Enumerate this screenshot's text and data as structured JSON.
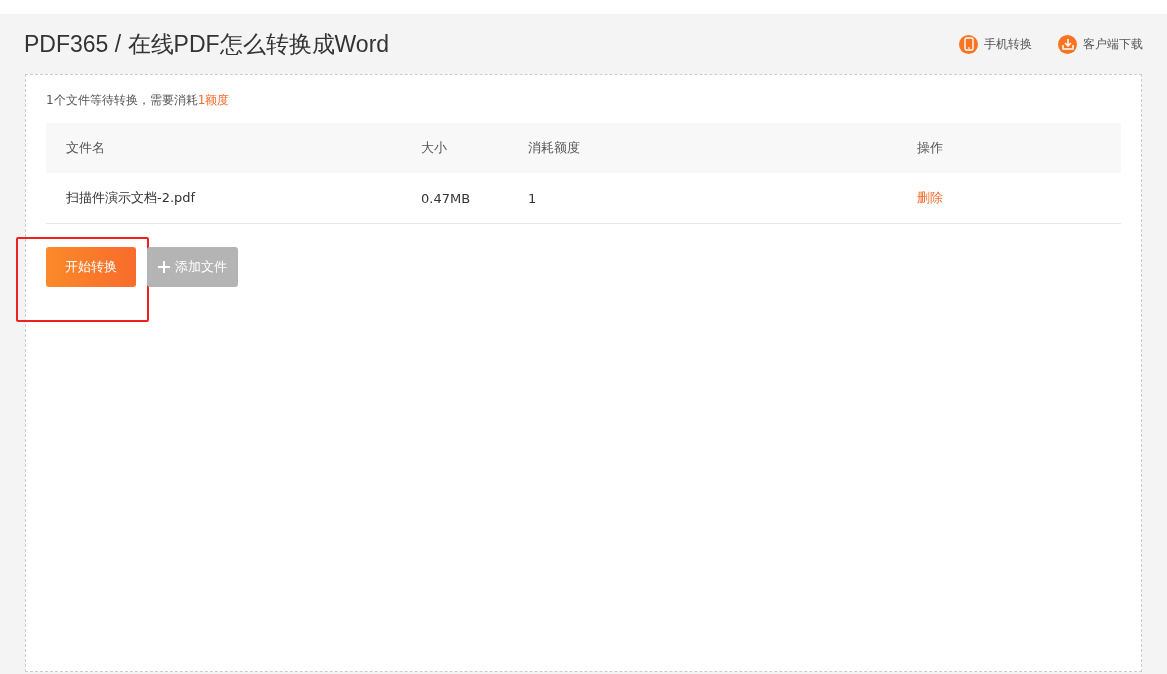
{
  "header": {
    "title": "PDF365 / 在线PDF怎么转换成Word",
    "links": [
      {
        "kind": "phone",
        "label": "手机转换"
      },
      {
        "kind": "download",
        "label": "客户端下载"
      }
    ]
  },
  "summary": {
    "text": "1个文件等待转换，需要消耗",
    "highlight": "1额度"
  },
  "table": {
    "columns": [
      "文件名",
      "大小",
      "消耗额度",
      "操作"
    ],
    "rows": [
      {
        "name": "扫描件演示文档-2.pdf",
        "size": "0.47MB",
        "quota": "1",
        "action": "删除"
      }
    ]
  },
  "buttons": [
    {
      "kind": "primary",
      "label": "开始转换",
      "disabled": false,
      "highlighted": true
    },
    {
      "kind": "add",
      "label": "添加文件",
      "disabled": true,
      "highlighted": false
    }
  ]
}
